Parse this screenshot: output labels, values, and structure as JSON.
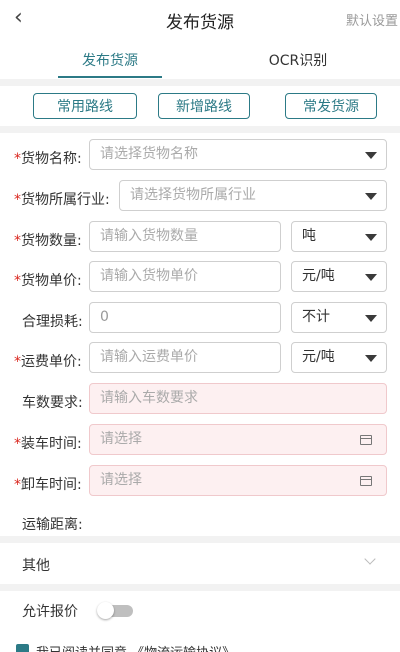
{
  "header": {
    "back_icon": "back-arrow-icon",
    "title": "发布货源",
    "default_settings": "默认设置"
  },
  "tabs": [
    {
      "label": "发布货源",
      "active": true
    },
    {
      "label": "OCR识别",
      "active": false
    }
  ],
  "quick_buttons": [
    "常用路线",
    "新增路线",
    "常发货源"
  ],
  "form": {
    "goods_name": {
      "label": "货物名称:",
      "required": true,
      "placeholder": "请选择货物名称"
    },
    "industry": {
      "label": "货物所属行业:",
      "required": true,
      "placeholder": "请选择货物所属行业"
    },
    "quantity": {
      "label": "货物数量:",
      "required": true,
      "placeholder": "请输入货物数量",
      "unit": "吨"
    },
    "unit_price": {
      "label": "货物单价:",
      "required": true,
      "placeholder": "请输入货物单价",
      "unit": "元/吨"
    },
    "loss": {
      "label": "合理损耗:",
      "required": false,
      "value": "0",
      "unit": "不计"
    },
    "freight": {
      "label": "运费单价:",
      "required": true,
      "placeholder": "请输入运费单价",
      "unit": "元/吨"
    },
    "vehicles": {
      "label": "车数要求:",
      "required": false,
      "placeholder": "请输入车数要求"
    },
    "load_time": {
      "label": "装车时间:",
      "required": true,
      "placeholder": "请选择"
    },
    "unload_time": {
      "label": "卸车时间:",
      "required": true,
      "placeholder": "请选择"
    },
    "distance": {
      "label": "运输距离:",
      "required": false
    }
  },
  "other": {
    "label": "其他"
  },
  "allow_quote": {
    "label": "允许报价",
    "enabled": false
  },
  "agreement": {
    "text": "我已阅读并同意 《物流运输协议》",
    "checked": true
  },
  "colors": {
    "accent": "#2c7a86",
    "required": "#d9251d",
    "pink_field": "#fdf0f1"
  }
}
